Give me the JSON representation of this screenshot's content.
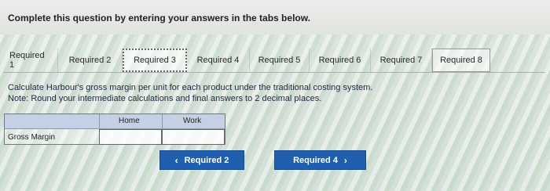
{
  "prompt": "Complete this question by entering your answers in the tabs below.",
  "tabs": [
    {
      "label": "Required 1"
    },
    {
      "label": "Required 2"
    },
    {
      "label": "Required 3"
    },
    {
      "label": "Required 4"
    },
    {
      "label": "Required 5"
    },
    {
      "label": "Required 6"
    },
    {
      "label": "Required 7"
    },
    {
      "label": "Required 8"
    }
  ],
  "active_tab": "Required 3",
  "instructions": {
    "line1": "Calculate Harbour's gross margin per unit for each product under the traditional costing system.",
    "line2": "Note: Round your intermediate calculations and final answers to 2 decimal places."
  },
  "table": {
    "headers": {
      "home": "Home",
      "work": "Work"
    },
    "row_label": "Gross Margin",
    "home_value": "",
    "work_value": ""
  },
  "nav": {
    "prev_label": "Required 2",
    "next_label": "Required 4",
    "prev_icon": "chevron-left-icon",
    "next_icon": "chevron-right-icon"
  },
  "colors": {
    "button_bg": "#1f5fae",
    "table_header_bg": "#c4d0e4"
  }
}
